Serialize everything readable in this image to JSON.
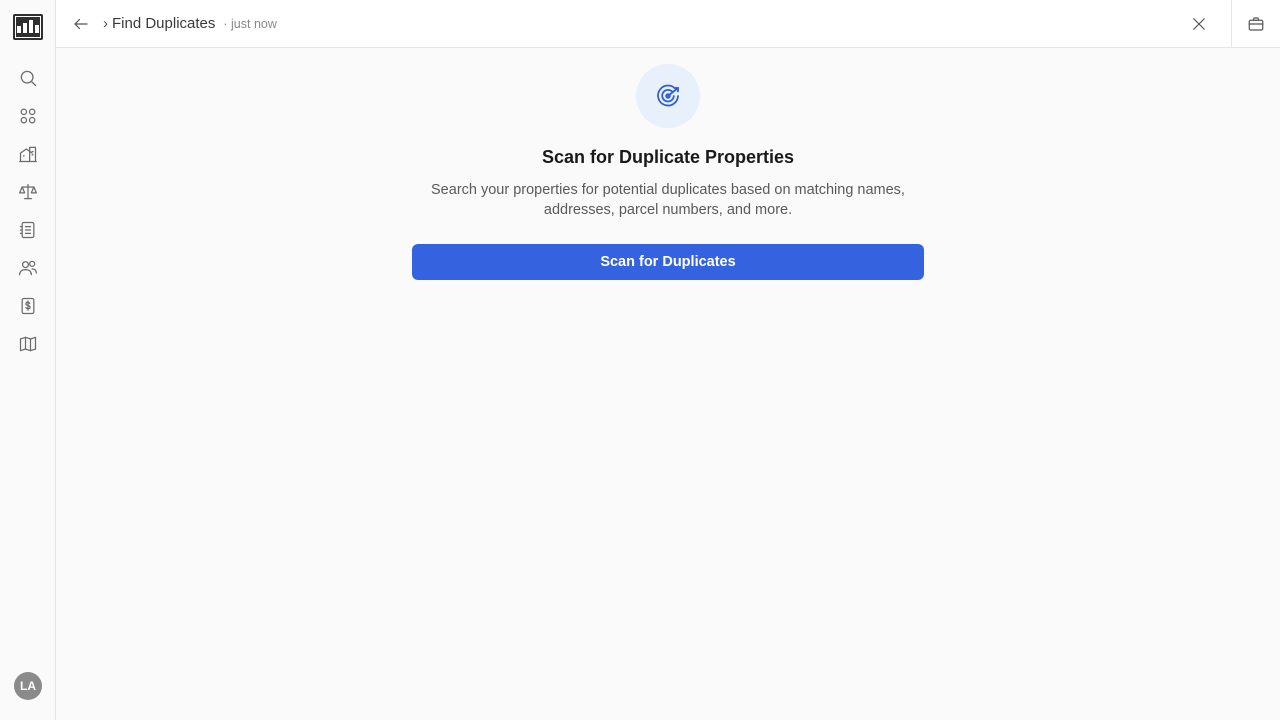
{
  "header": {
    "breadcrumb_separator": "›",
    "page_title": "Find Duplicates",
    "timestamp": "· just now"
  },
  "sidebar": {
    "items": [
      {
        "name": "search"
      },
      {
        "name": "dashboard"
      },
      {
        "name": "properties"
      },
      {
        "name": "legal"
      },
      {
        "name": "documents"
      },
      {
        "name": "contacts"
      },
      {
        "name": "billing"
      },
      {
        "name": "map"
      }
    ],
    "avatar_initials": "LA"
  },
  "main": {
    "title": "Scan for Duplicate Properties",
    "description": "Search your properties for potential duplicates based on matching names, addresses, parcel numbers, and more.",
    "scan_button_label": "Scan for Duplicates"
  },
  "colors": {
    "accent": "#3563e0",
    "icon_bg": "#e8f0fc"
  }
}
